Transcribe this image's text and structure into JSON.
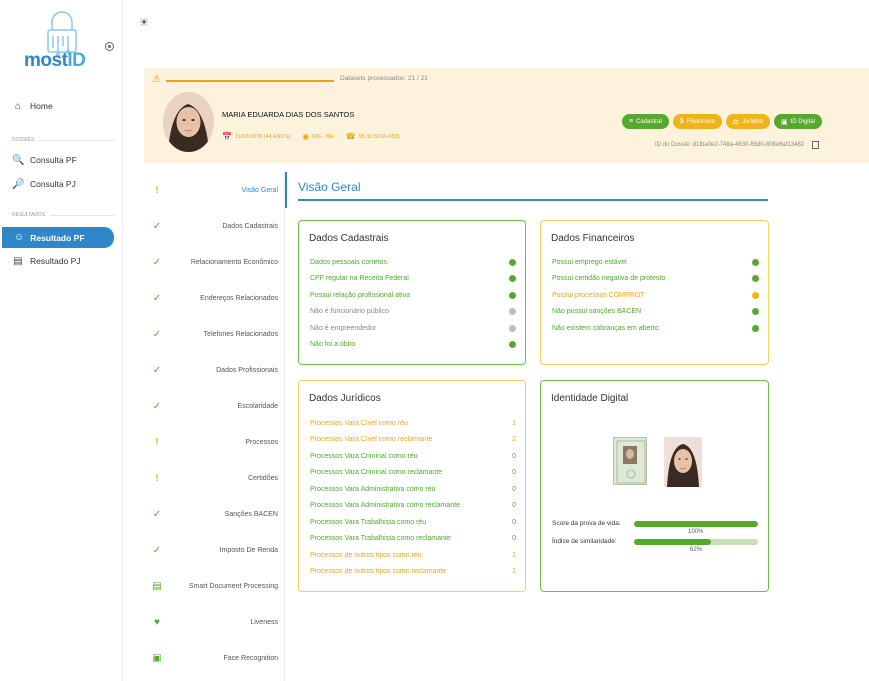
{
  "sidebar": {
    "logo_text_1": "most",
    "logo_text_2": "ID",
    "home": "Home",
    "section_dossies": "DOSSIÊS",
    "consulta_pf": "Consulta PF",
    "consulta_pj": "Consulta PJ",
    "section_resultados": "RESULTADOS",
    "resultado_pf": "Resultado PF",
    "resultado_pj": "Resultado PJ"
  },
  "header": {
    "progress_text": "Datasets processados: 21 / 21",
    "name": "MARIA EDUARDA DIAS DOS SANTOS",
    "birth": "11/03/1978 (44 ANOS)",
    "location": "MG - BH",
    "phone": "55 31 5210-4321",
    "chips": [
      "Cadastral",
      "Financeiro",
      "Jurídico",
      "ID Digital"
    ],
    "doc_id": "ID do Dossiê: d1fba0e2-748a-4630-85d0-808e6af13482"
  },
  "steps": [
    {
      "label": "Visão Geral",
      "status": "warn"
    },
    {
      "label": "Dados Cadastrais",
      "status": "ok"
    },
    {
      "label": "Relacionamento Econômico",
      "status": "ok"
    },
    {
      "label": "Endereços Relacionados",
      "status": "ok"
    },
    {
      "label": "Telefones Relacionados",
      "status": "ok"
    },
    {
      "label": "Dados Profissionais",
      "status": "ok"
    },
    {
      "label": "Escolaridade",
      "status": "ok"
    },
    {
      "label": "Processos",
      "status": "warn"
    },
    {
      "label": "Certidões",
      "status": "warn"
    },
    {
      "label": "Sanções BACEN",
      "status": "ok"
    },
    {
      "label": "Imposto De Renda",
      "status": "ok"
    },
    {
      "label": "Smart Document Processing",
      "status": "doc"
    },
    {
      "label": "Liveness",
      "status": "heart"
    },
    {
      "label": "Face Recognition",
      "status": "face"
    }
  ],
  "main": {
    "title": "Visão Geral",
    "cadastrais": {
      "title": "Dados Cadastrais",
      "rows": [
        {
          "label": "Dados pessoais corretos",
          "status": "g"
        },
        {
          "label": "CPF regular na Receita Federal",
          "status": "g"
        },
        {
          "label": "Possui relação profissional ativa",
          "status": "g"
        },
        {
          "label": "Não é funcionário público",
          "status": "gray"
        },
        {
          "label": "Não é empreendedor",
          "status": "gray"
        },
        {
          "label": "Não foi a óbito",
          "status": "g"
        }
      ]
    },
    "financeiros": {
      "title": "Dados Financeiros",
      "rows": [
        {
          "label": "Possui emprego estável",
          "status": "g"
        },
        {
          "label": "Possui certidão negativa de protesto",
          "status": "g"
        },
        {
          "label": "Possui processos COMPROT",
          "status": "y"
        },
        {
          "label": "Não possui sanções BACEN",
          "status": "g"
        },
        {
          "label": "Não existem cobranças em aberto",
          "status": "g"
        }
      ]
    },
    "juridicos": {
      "title": "Dados Jurídicos",
      "rows": [
        {
          "label": "Processos Vara Cível como réu",
          "value": "1",
          "status": "y"
        },
        {
          "label": "Processos Vara Cível como reclamante",
          "value": "2",
          "status": "y"
        },
        {
          "label": "Processos Vara Criminal como réu",
          "value": "0",
          "status": "g"
        },
        {
          "label": "Processos Vara Criminal como reclamante",
          "value": "0",
          "status": "g"
        },
        {
          "label": "Processos Vara Administrativa como réu",
          "value": "0",
          "status": "g"
        },
        {
          "label": "Processos Vara Administrativa como reclamante",
          "value": "0",
          "status": "g"
        },
        {
          "label": "Processos Vara Trabalhista como réu",
          "value": "0",
          "status": "g"
        },
        {
          "label": "Processos Vara Trabalhista como reclamante",
          "value": "0",
          "status": "g"
        },
        {
          "label": "Processos de outros tipos como réu",
          "value": "1",
          "status": "y"
        },
        {
          "label": "Processos de outros tipos como reclamante",
          "value": "1",
          "status": "y"
        }
      ]
    },
    "identidade": {
      "title": "Identidade Digital",
      "score_label": "Score da prova de vida:",
      "score_pct": "100%",
      "score_fraction": 1.0,
      "sim_label": "Índice de similaridade:",
      "sim_pct": "62%",
      "sim_fraction": 0.62
    }
  },
  "colors": {
    "primary": "#2f86c8",
    "green": "#55aa2d",
    "yellow": "#f0b41a",
    "header_bg": "#fdf3dc"
  }
}
